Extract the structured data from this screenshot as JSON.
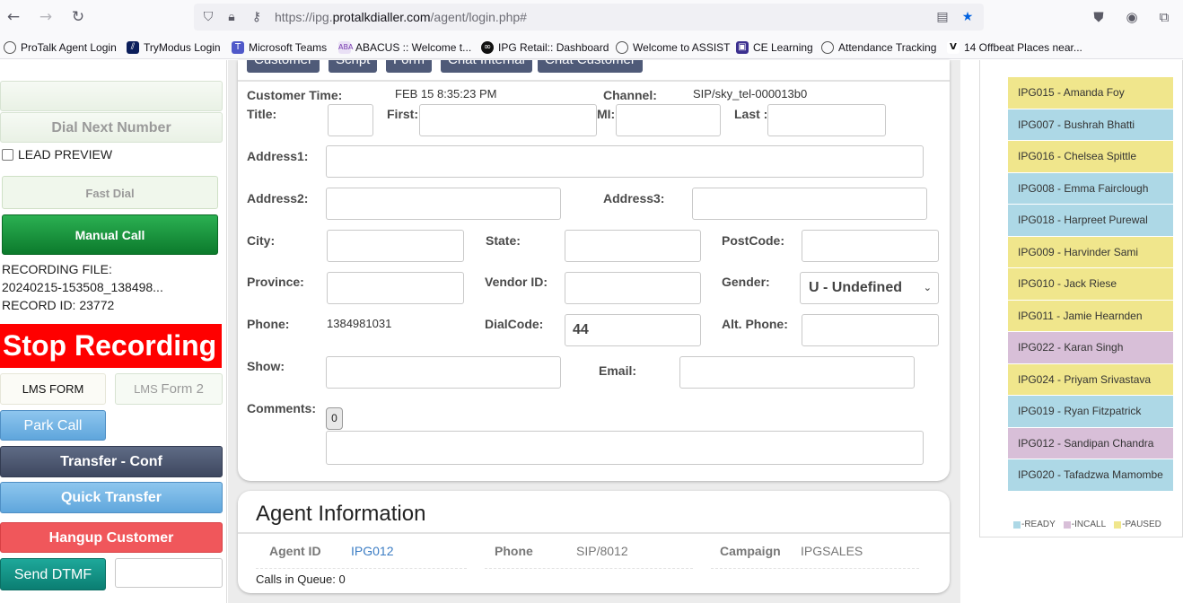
{
  "browser": {
    "url_prefix": "https://ipg.",
    "url_domain": "protalkdialler.com",
    "url_path": "/agent/login.php#",
    "bookmarks": [
      "ProTalk Agent Login",
      "TryModus Login",
      "Microsoft Teams",
      "ABACUS :: Welcome t...",
      "IPG Retail:: Dashboard",
      "Welcome to ASSIST",
      "CE Learning",
      "Attendance Tracking",
      "14 Offbeat Places near..."
    ]
  },
  "left": {
    "dial_next": "Dial Next Number",
    "lead_preview": "LEAD PREVIEW",
    "fast_dial": "Fast Dial",
    "manual_call": "Manual Call",
    "recording_file_label": "RECORDING FILE:",
    "recording_file_value": "20240215-153508_138498...",
    "record_id": "RECORD ID: 23772",
    "stop_recording": "Stop Recording",
    "lms_form": "LMS FORM",
    "lms_form2_a": "LMS",
    "lms_form2_b": "Form 2",
    "park_call": "Park Call",
    "transfer_conf": "Transfer - Conf",
    "quick_transfer": "Quick Transfer",
    "hangup_customer": "Hangup Customer",
    "send_dtmf": "Send DTMF"
  },
  "form": {
    "tabs": [
      "Customer",
      "Script",
      "Form",
      "Chat Internal",
      "Chat Customer"
    ],
    "customer_time_label": "Customer Time:",
    "customer_time_value": "FEB 15 8:35:23 PM",
    "channel_label": "Channel:",
    "channel_value": "SIP/sky_tel-000013b0",
    "title_label": "Title:",
    "first_label": "First:",
    "mi_label": "MI:",
    "last_label": "Last :",
    "address1_label": "Address1:",
    "address2_label": "Address2:",
    "address3_label": "Address3:",
    "city_label": "City:",
    "state_label": "State:",
    "postcode_label": "PostCode:",
    "province_label": "Province:",
    "vendor_label": "Vendor ID:",
    "gender_label": "Gender:",
    "gender_value": "U - Undefined",
    "phone_label": "Phone:",
    "phone_value": "1384981031",
    "dialcode_label": "DialCode:",
    "dialcode_value": "44",
    "altphone_label": "Alt. Phone:",
    "show_label": "Show:",
    "email_label": "Email:",
    "comments_label": "Comments:",
    "comments_count": "0"
  },
  "agent_info": {
    "title": "Agent Information",
    "agent_id_label": "Agent ID",
    "agent_id_value": "IPG012",
    "phone_label": "Phone",
    "phone_value": "SIP/8012",
    "campaign_label": "Campaign",
    "campaign_value": "IPGSALES",
    "calls_in_queue": "Calls in Queue: 0"
  },
  "agents": [
    {
      "name": "IPG015 - Amanda Foy",
      "status": "paused"
    },
    {
      "name": "IPG007 - Bushrah Bhatti",
      "status": "ready"
    },
    {
      "name": "IPG016 - Chelsea Spittle",
      "status": "paused"
    },
    {
      "name": "IPG008 - Emma Fairclough",
      "status": "ready"
    },
    {
      "name": "IPG018 - Harpreet Purewal",
      "status": "ready"
    },
    {
      "name": "IPG009 - Harvinder Sami",
      "status": "paused"
    },
    {
      "name": "IPG010 - Jack Riese",
      "status": "paused"
    },
    {
      "name": "IPG011 - Jamie Hearnden",
      "status": "paused"
    },
    {
      "name": "IPG022 - Karan Singh",
      "status": "incall"
    },
    {
      "name": "IPG024 - Priyam Srivastava",
      "status": "paused"
    },
    {
      "name": "IPG019 - Ryan Fitzpatrick",
      "status": "ready"
    },
    {
      "name": "IPG012 - Sandipan Chandra",
      "status": "incall"
    },
    {
      "name": "IPG020 - Tafadzwa Mamombe",
      "status": "ready"
    }
  ],
  "legend": {
    "ready": "-READY",
    "incall": "-INCALL",
    "paused": "-PAUSED"
  },
  "colors": {
    "ready": "#add8e6",
    "incall": "#d8bfd8",
    "paused": "#f0e68c",
    "stop_recording": "#ff0000",
    "manual_call": "#1a9441",
    "tab": "#4f5a78"
  }
}
